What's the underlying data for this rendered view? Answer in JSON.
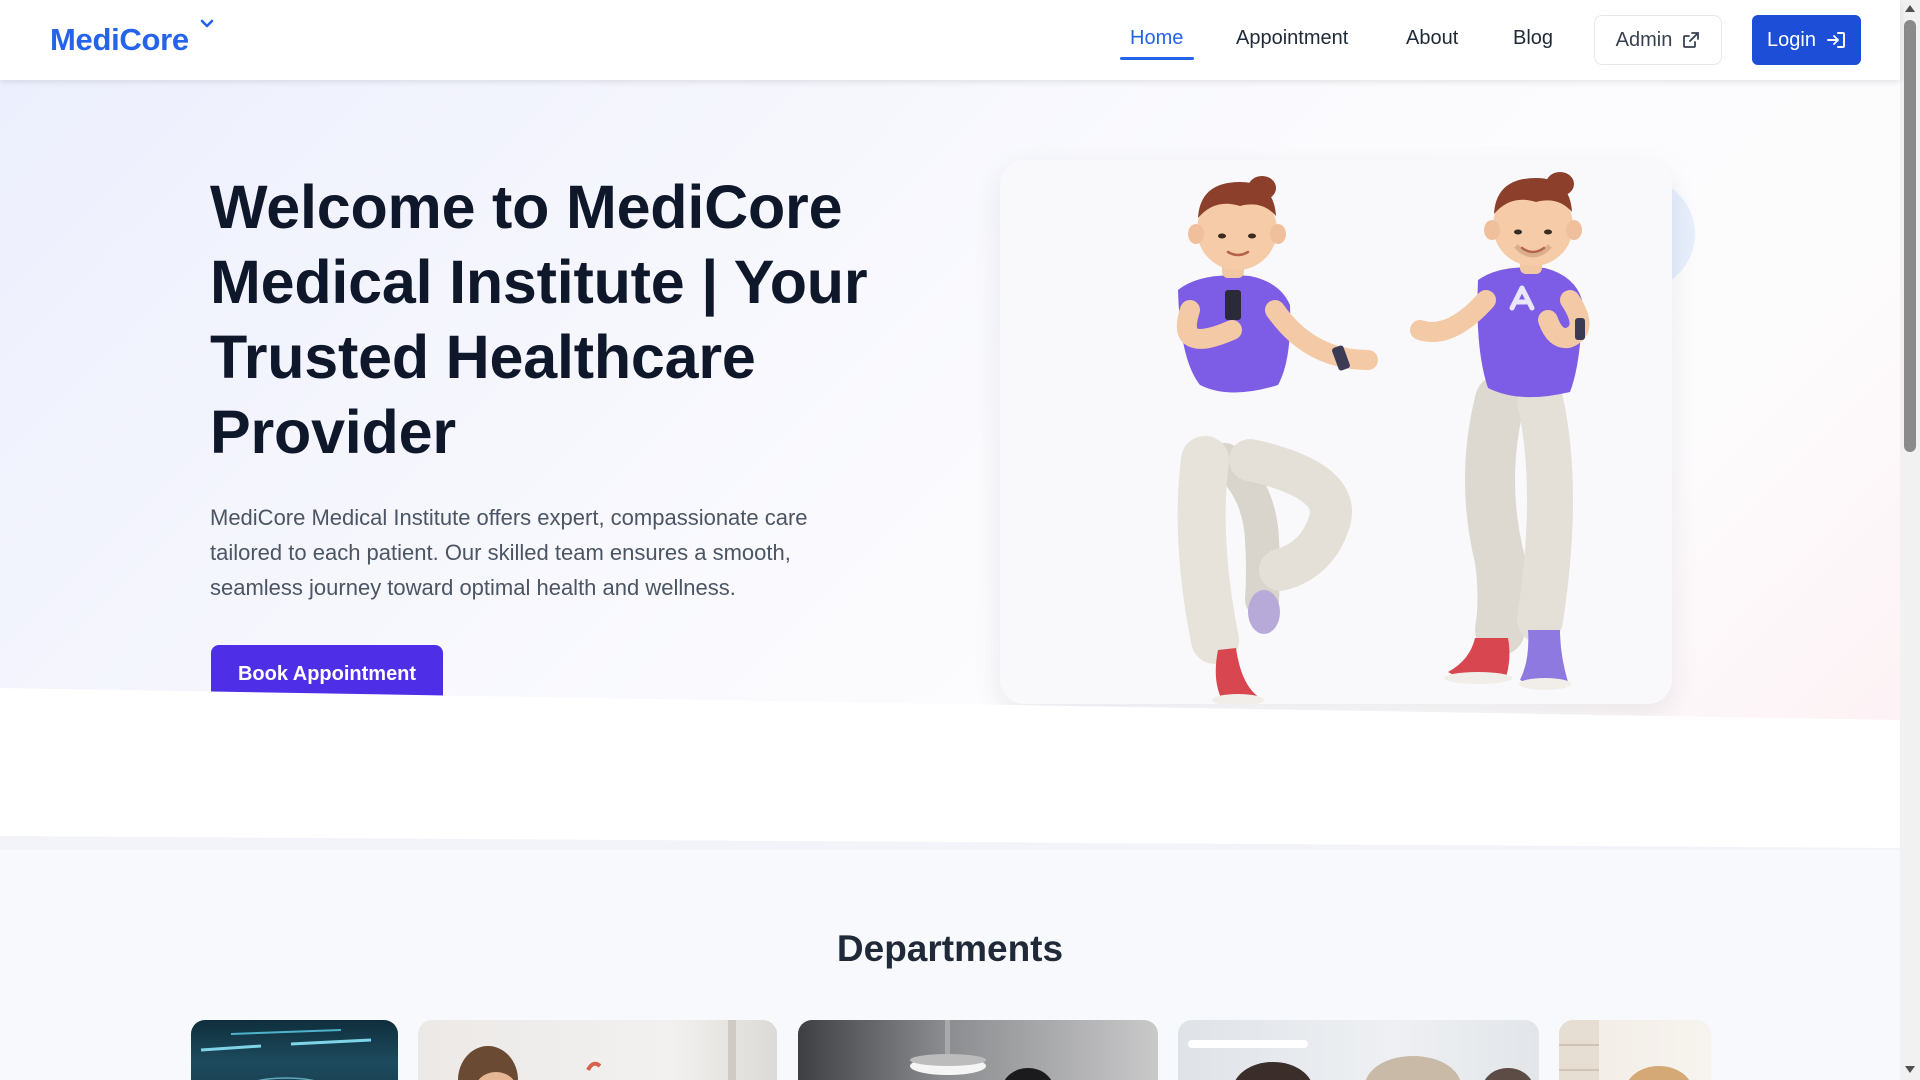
{
  "navbar": {
    "brand": "MediCore",
    "links": [
      {
        "label": "Home",
        "active": true
      },
      {
        "label": "Appointment",
        "active": false
      },
      {
        "label": "About",
        "active": false
      },
      {
        "label": "Blog",
        "active": false
      }
    ],
    "admin_label": "Admin",
    "login_label": "Login"
  },
  "hero": {
    "title": "Welcome to MediCore Medical Institute | Your Trusted Healthcare Provider",
    "description": "MediCore Medical Institute offers expert, compassionate care tailored to each patient. Our skilled team ensures a smooth, seamless journey toward optimal health and wellness.",
    "cta_label": "Book Appointment"
  },
  "departments": {
    "title": "Departments"
  },
  "colors": {
    "primary": "#2563eb",
    "cta": "#4f2ee8",
    "heading": "#0f172a"
  }
}
